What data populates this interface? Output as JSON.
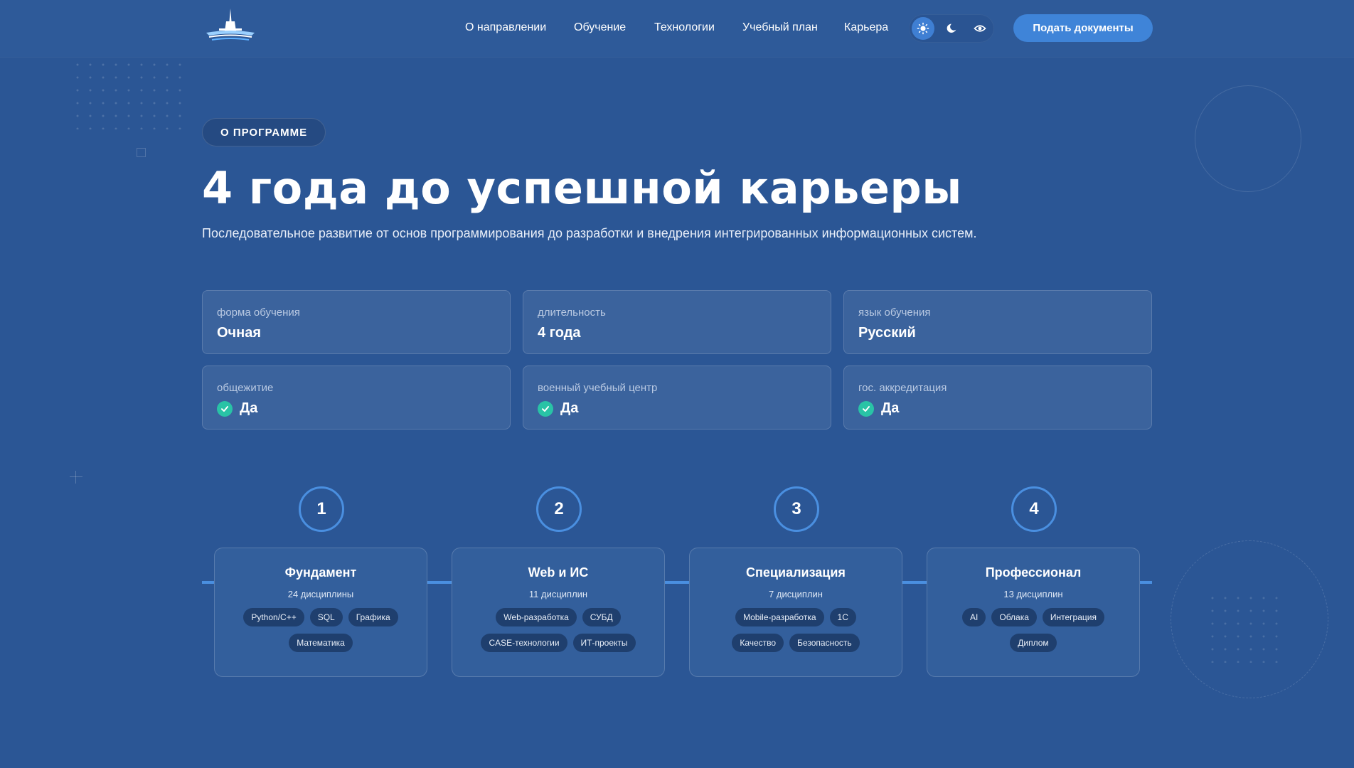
{
  "header": {
    "nav": [
      {
        "label": "О направлении",
        "name": "nav-about"
      },
      {
        "label": "Обучение",
        "name": "nav-education"
      },
      {
        "label": "Технологии",
        "name": "nav-technologies"
      },
      {
        "label": "Учебный план",
        "name": "nav-curriculum"
      },
      {
        "label": "Карьера",
        "name": "nav-career"
      }
    ],
    "theme": {
      "active": "light",
      "options": [
        "sun-icon",
        "moon-icon",
        "eye-icon"
      ]
    },
    "cta_label": "Подать документы"
  },
  "hero": {
    "badge": "О ПРОГРАММЕ",
    "title": "4 года до успешной карьеры",
    "subtitle": "Последовательное развитие от основ программирования до разработки и внедрения интегрированных информационных систем."
  },
  "info": [
    {
      "label": "форма обучения",
      "value": "Очная",
      "check": false
    },
    {
      "label": "длительность",
      "value": "4 года",
      "check": false
    },
    {
      "label": "язык обучения",
      "value": "Русский",
      "check": false
    },
    {
      "label": "общежитие",
      "value": "Да",
      "check": true
    },
    {
      "label": "военный учебный центр",
      "value": "Да",
      "check": true
    },
    {
      "label": "гос. аккредитация",
      "value": "Да",
      "check": true
    }
  ],
  "steps": [
    {
      "number": "1",
      "title": "Фундамент",
      "count": "24 дисциплины",
      "tags": [
        "Python/C++",
        "SQL",
        "Графика",
        "Математика"
      ]
    },
    {
      "number": "2",
      "title": "Web и ИС",
      "count": "11 дисциплин",
      "tags": [
        "Web-разработка",
        "СУБД",
        "CASE-технологии",
        "ИТ-проекты"
      ]
    },
    {
      "number": "3",
      "title": "Специализация",
      "count": "7 дисциплин",
      "tags": [
        "Mobile-разработка",
        "1С",
        "Качество",
        "Безопасность"
      ]
    },
    {
      "number": "4",
      "title": "Профессионал",
      "count": "13 дисциплин",
      "tags": [
        "AI",
        "Облака",
        "Интеграция",
        "Диплом"
      ]
    }
  ],
  "colors": {
    "background": "#2b5695",
    "accent": "#3f84d8",
    "timeline": "#4a8fe0",
    "check": "#29c3a6"
  }
}
